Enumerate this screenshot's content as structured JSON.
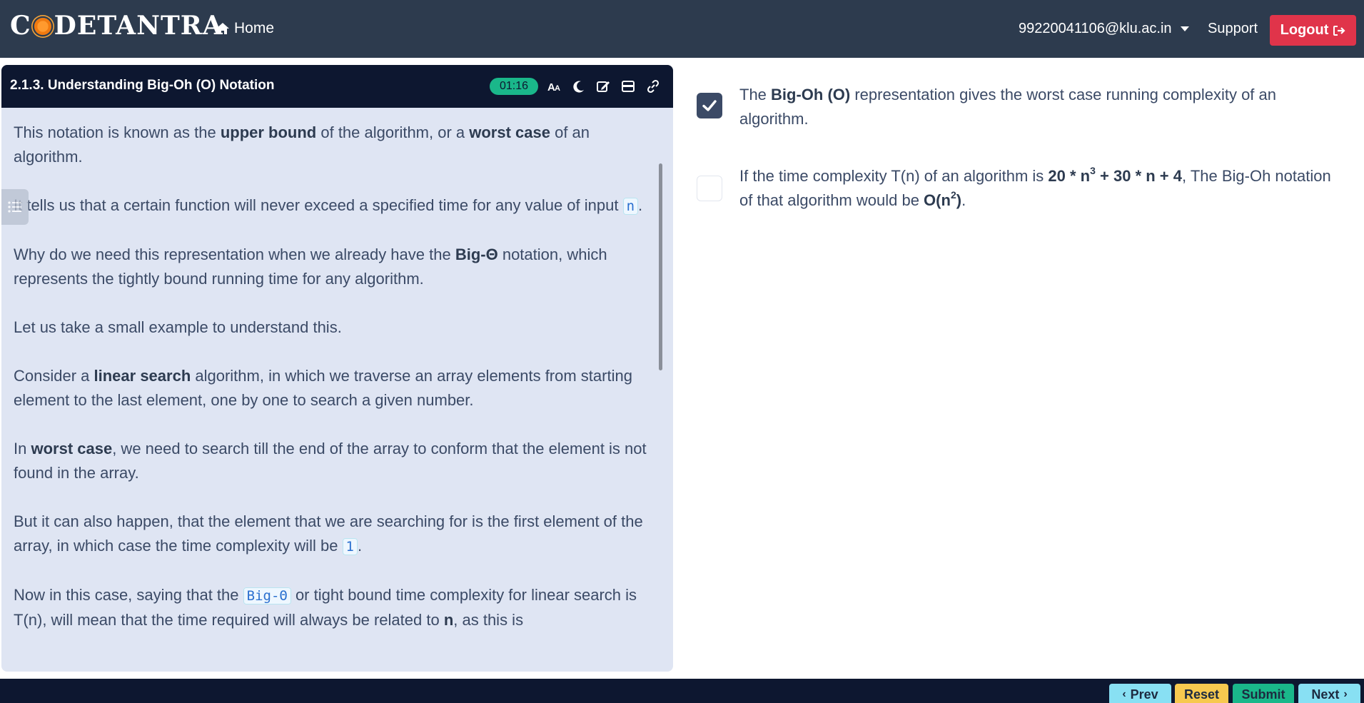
{
  "navbar": {
    "brand": {
      "part1": "C",
      "part2": "DETANTRA"
    },
    "home_label": "Home",
    "user_email": "99220041106@klu.ac.in",
    "support_label": "Support",
    "logout_label": "Logout"
  },
  "panel": {
    "title": "2.1.3. Understanding Big-Oh (O) Notation",
    "timer": "01:16",
    "icons": [
      "font-size-icon",
      "moon-icon",
      "edit-icon",
      "layout-icon",
      "link-icon"
    ]
  },
  "content": {
    "p1": {
      "a": "This notation is known as the ",
      "b": "upper bound",
      "c": " of the algorithm, or a ",
      "d": "worst case",
      "e": " of an algorithm."
    },
    "p2": {
      "a": "It tells us that a certain function will never exceed a specified time for any value of input ",
      "code": "n",
      "b": "."
    },
    "p3": {
      "a": "Why do we need this representation when we already have the ",
      "b": "Big-Θ",
      "c": " notation, which represents the tightly bound running time for any algorithm."
    },
    "p4": "Let us take a small example to understand this.",
    "p5": {
      "a": "Consider a ",
      "b": "linear search",
      "c": " algorithm, in which we traverse an array elements from starting element to the last element, one by one to search a given number."
    },
    "p6": {
      "a": "In ",
      "b": "worst case",
      "c": ", we need to search till the end of the array to conform that the element is not found in the array."
    },
    "p7": {
      "a": "But it can also happen, that the element that we are searching for is the first element of the array, in which case the time complexity will be ",
      "code": "1",
      "b": "."
    },
    "p8": {
      "a": "Now in this case, saying that the ",
      "code": "Big-Θ",
      "b": " or tight bound time complexity for linear search is T(n), will mean that the time required will always be related to ",
      "c": "n",
      "d": ", as this is"
    }
  },
  "options": [
    {
      "checked": true,
      "a": "The ",
      "b": "Big-Oh (O)",
      "c": " representation gives the worst case running complexity of an algorithm."
    },
    {
      "checked": false,
      "a": "If the time complexity T(n) of an algorithm is ",
      "b1": "20 * n",
      "b_sup": "3",
      "b2": " + 30 * n + 4",
      "c": ", The Big-Oh notation of that algorithm would be ",
      "d1": "O(n",
      "d_sup": "2",
      "d2": ")",
      "e": "."
    }
  ],
  "footer": {
    "prev_label": "Prev",
    "reset_label": "Reset",
    "submit_label": "Submit",
    "next_label": "Next"
  },
  "colors": {
    "navbar_bg": "#2d3b4e",
    "panel_header_bg": "#0d1730",
    "panel_bg": "#dfe5f3",
    "logout": "#e0344a",
    "timer": "#1ab78a",
    "text": "#3b4a66"
  }
}
